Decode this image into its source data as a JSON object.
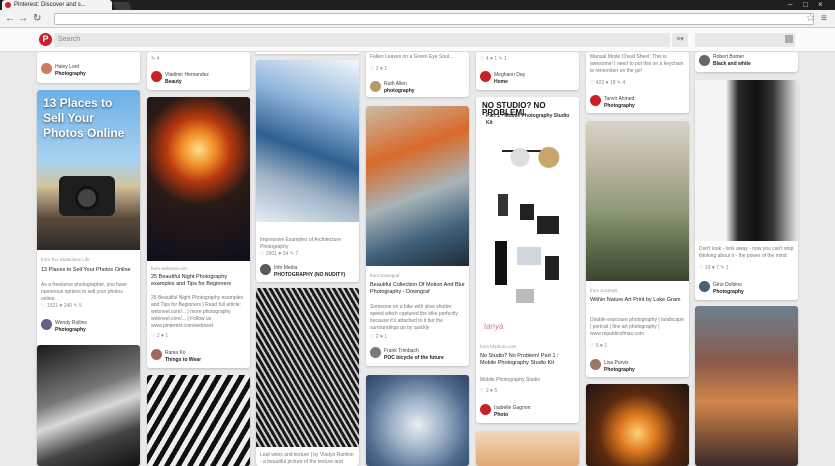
{
  "browser": {
    "tab_title": "Pinterest: Discover and s...",
    "back": "←",
    "forward": "→",
    "reload": "↻",
    "star": "☆",
    "menu": "≡",
    "win_min": "–",
    "win_max": "□",
    "win_close": "×"
  },
  "pinbar": {
    "logo": "P",
    "search_placeholder": "Search",
    "menu_icon": "≡▾",
    "msg_icon": "✉"
  },
  "pins": {
    "c1a": {
      "user": "Haley Lord",
      "board": "Photography"
    },
    "c1b": {
      "title": "13 Places to Sell Your Photos Online",
      "source": "from Too Shabulous Life",
      "desc_title": "13 Places to Sell Your Photos Online",
      "desc": "As a freelance photographer, you have numerous options to sell your photos online.",
      "stats": "♡ 1521  ♥ 240  ✎ 5",
      "user": "Wendy Rollins",
      "board": "Photography"
    },
    "c2a": {
      "user": "Vladimir Hernandez",
      "board": "Beauty",
      "stats": "✎ 4"
    },
    "c2b": {
      "source": "from webneel.com",
      "title": "25 Beautiful Night Photography examples and Tips for Beginners",
      "desc": "25 Beautiful Night Photography examples and Tips for Beginners | Read full article: webneel.com/... | more photography webneel.com/... | Follow us www.pinterest.com/webneel",
      "stats": "♡ 2  ♥ 1",
      "user": "Rania Ko",
      "board": "Things to Wear"
    },
    "c3a": {
      "stats": "♡ 2  ♥ 1"
    },
    "c3b": {
      "desc": "Impressive Examples of Architecture Photography",
      "stats": "♡ 2901  ♥ 34  ✎ 7",
      "user": "Info Media",
      "board": "PHOTOGRAPHY (NO NUDITY)"
    },
    "c3c": {
      "desc": "Leaf veins and texture | by Vladyn Ramkin - a beautiful picture of the texture and detail"
    },
    "c4a": {
      "desc": "Fallen Leaves on a Green Eye Soul...",
      "stats": "♡ 2  ♥ 1",
      "user": "Ruth Allen",
      "board": "photography"
    },
    "c4b": {
      "source": "from Downgraf",
      "title": "Beautiful Collection Of Motion And Blur Photography - Downgraf",
      "desc": "Someone on a bike with slow shutter speed which captured the bike perfectly because it's attached to it but the surroundings go by quickly",
      "stats": "♡ 2  ♥ 1",
      "user": "Frank Trimbach",
      "board": "POC bicycle of the future"
    },
    "c5a": {
      "stats": "♡ 4  ♥ 1  ✎ 1",
      "user": "Meghann Day",
      "board": "Home"
    },
    "c5b": {
      "head": "NO STUDIO? NO PROBLEM!",
      "sub": "Part 1 - Mobile Photography Studio Kit",
      "brand": "tanya",
      "source": "from bhphoto.com",
      "title": "No Studio? No Problem! Part 1 : Mobile Photography Studio Kit",
      "desc": "Mobile Photography Studio",
      "stats": "♡ 2  ♥ 5",
      "user": "Isabelle Gagnon",
      "board": "Photo"
    },
    "c6a": {
      "desc": "Manual Mode Cheat Sheet. This is awesome! I need to put this on a keychain to remember on the go!",
      "stats": "♡ 423  ♥ 18  ✎ 4",
      "user": "Tanvir Ahmed",
      "board": "Photography"
    },
    "c6b": {
      "source": "from Society6",
      "title": "Within Nature Art Print by Luke Gram",
      "desc": "Double exposure photography | landscape | portrait | fine art photography | www.republicofmax.com",
      "stats": "♡ 5  ♥ 1",
      "user": "Lisa Purvis",
      "board": "Photography"
    },
    "c7a": {
      "user": "Robert Bomer",
      "board": "Black and white"
    },
    "c7b": {
      "desc": "Don't look - look away - now you can't stop thinking about it - the power of the mind",
      "stats": "♡ 19  ♥ 7  ✎ 1",
      "user": "Gino Dolbino",
      "board": "Photography"
    }
  }
}
